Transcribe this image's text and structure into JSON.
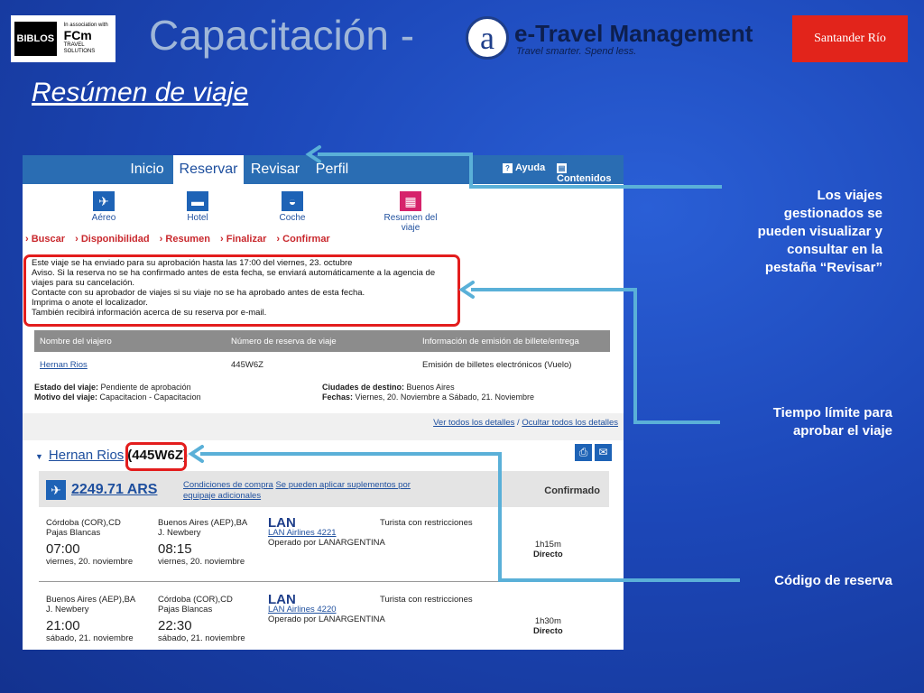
{
  "header": {
    "biblos_logo": "BIBLOS",
    "assoc_text": "In association with",
    "fcm_logo": "FCm",
    "fcm_sub": "TRAVEL SOLUTIONS",
    "capacitacion": "Capacitación -",
    "etm_icon": "a",
    "etm_title": "e-Travel Management",
    "etm_subtitle": "Travel smarter. Spend less.",
    "santander": "Santander Río"
  },
  "page_title": "Resúmen de viaje",
  "app": {
    "tabs": [
      "Inicio",
      "Reservar",
      "Revisar",
      "Perfil"
    ],
    "help_links": {
      "ayuda": "Ayuda",
      "contenidos": "Contenidos"
    },
    "service_icons": [
      "Aéreo",
      "Hotel",
      "Coche",
      "Resumen del viaje"
    ],
    "breadcrumb": [
      "Buscar",
      "Disponibilidad",
      "Resumen",
      "Finalizar",
      "Confirmar"
    ],
    "notice_lines": [
      "Este viaje se ha enviado para su aprobación hasta las 17:00 del viernes, 23. octubre",
      "Aviso. Si la reserva no se ha confirmado antes de esta fecha, se enviará automáticamente a la agencia de",
      "viajes para su cancelación.",
      "Contacte con su aprobador de viajes si su viaje no se ha aprobado antes de esta fecha.",
      "Imprima o anote el localizador.",
      "También recibirá información acerca de su reserva por e-mail."
    ],
    "table": {
      "headers": [
        "Nombre del viajero",
        "Número de reserva de viaje",
        "Información de emisión de billete/entrega"
      ],
      "row": [
        "Hernan Rios",
        "445W6Z",
        "Emisión de billetes electrónicos (Vuelo)"
      ]
    },
    "trip_meta": {
      "estado_label": "Estado del viaje:",
      "estado": "Pendiente de aprobación",
      "motivo_label": "Motivo del viaje:",
      "motivo": "Capacitacion - Capacitacion",
      "destino_label": "Ciudades de destino:",
      "destino": "Buenos Aires",
      "fechas_label": "Fechas:",
      "fechas": "Viernes, 20. Noviembre a Sábado, 21. Noviembre"
    },
    "links": {
      "ver": "Ver todos los detalles",
      "sep": "/",
      "ocultar": "Ocultar todos los detalles"
    },
    "passenger": {
      "name": "Hernan Rios",
      "code": "(445W6Z)"
    },
    "price": "2249.71 ARS",
    "price_links": {
      "condiciones": "Condiciones de compra",
      "suplementos": "Se pueden aplicar suplementos por",
      "equipaje": "equipaje adicionales"
    },
    "status": "Confirmado",
    "segments": [
      {
        "from_city": "Córdoba (COR),CD",
        "from_airport": "Pajas Blancas",
        "dep_time": "07:00",
        "dep_date": "viernes, 20. noviembre",
        "to_city": "Buenos Aires (AEP),BA",
        "to_airport": "J. Newbery",
        "arr_time": "08:15",
        "arr_date": "viernes, 20. noviembre",
        "airline_logo": "LAN",
        "flight": "LAN Airlines 4221",
        "operated": "Operado por LANARGENTINA",
        "fare": "Turista con restricciones",
        "duration": "1h15m",
        "type": "Directo"
      },
      {
        "from_city": "Buenos Aires (AEP),BA",
        "from_airport": "J. Newbery",
        "dep_time": "21:00",
        "dep_date": "sábado, 21. noviembre",
        "to_city": "Córdoba (COR),CD",
        "to_airport": "Pajas Blancas",
        "arr_time": "22:30",
        "arr_date": "sábado, 21. noviembre",
        "airline_logo": "LAN",
        "flight": "LAN Airlines 4220",
        "operated": "Operado por LANARGENTINA",
        "fare": "Turista con restricciones",
        "duration": "1h30m",
        "type": "Directo"
      }
    ]
  },
  "callouts": {
    "revisar": [
      "Los viajes",
      "gestionados se",
      "pueden visualizar y",
      "consultar en la",
      "pestaña “Revisar”"
    ],
    "tiempo": [
      "Tiempo límite para",
      "aprobar el viaje"
    ],
    "codigo": "Código de reserva"
  },
  "colors": {
    "accent": "#2a6db3",
    "highlight": "#e31d1d",
    "arrow": "#5ab0d8"
  }
}
